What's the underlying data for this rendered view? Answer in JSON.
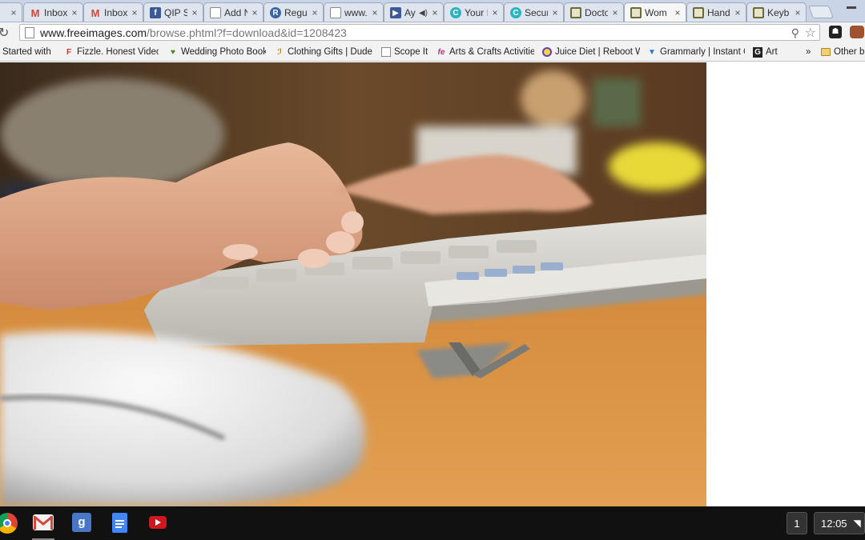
{
  "tabs": [
    {
      "title": "",
      "icon": "page-icon",
      "close": "×"
    },
    {
      "title": "Inbox",
      "icon": "gmail-icon",
      "close": "×"
    },
    {
      "title": "Inbox",
      "icon": "gmail-icon",
      "close": "×"
    },
    {
      "title": "QIP S",
      "icon": "facebook-icon",
      "close": "×"
    },
    {
      "title": "Add N",
      "icon": "page-icon",
      "close": "×"
    },
    {
      "title": "Regul",
      "icon": "regulator-icon",
      "close": "×"
    },
    {
      "title": "www.",
      "icon": "page-icon",
      "close": "×"
    },
    {
      "title": "Ay",
      "icon": "video-icon",
      "close": "×"
    },
    {
      "title": "Your I",
      "icon": "c-icon",
      "close": "×"
    },
    {
      "title": "Secur",
      "icon": "c-icon",
      "close": "×"
    },
    {
      "title": "Docto",
      "icon": "photo-icon",
      "close": "×"
    },
    {
      "title": "Wom",
      "icon": "photo-icon",
      "close": "×"
    },
    {
      "title": "Hand",
      "icon": "photo-icon",
      "close": "×"
    },
    {
      "title": "Keyb",
      "icon": "photo-icon",
      "close": "×"
    }
  ],
  "address_bar": {
    "host": "www.freeimages.com",
    "path": "/browse.phtml?f=download&id=1208423"
  },
  "bookmarks": [
    {
      "label": "Started with",
      "icon": "none"
    },
    {
      "label": "Fizzle. Honest Video",
      "icon": "fizzle-icon"
    },
    {
      "label": "Wedding Photo Book",
      "icon": "wedding-icon"
    },
    {
      "label": "Clothing Gifts | Dude",
      "icon": "clothing-icon"
    },
    {
      "label": "Scope It",
      "icon": "page-icon"
    },
    {
      "label": "Arts & Crafts Activitie",
      "icon": "fe-icon"
    },
    {
      "label": "Juice Diet | Reboot W",
      "icon": "juice-icon"
    },
    {
      "label": "Grammarly | Instant G",
      "icon": "grammarly-icon"
    },
    {
      "label": "Art",
      "icon": "g-icon"
    },
    {
      "label": "»",
      "icon": "none"
    },
    {
      "label": "Other b",
      "icon": "folder-icon"
    }
  ],
  "shelf": {
    "apps": [
      "chrome-icon",
      "gmail-icon",
      "google-plus-icon",
      "docs-icon",
      "youtube-icon"
    ],
    "notification_count": "1",
    "clock": "12:05"
  },
  "colors": {
    "tabstrip": "#c9d4e6",
    "shelf": "#111111",
    "gmail_red": "#d44638",
    "youtube_red": "#cc181e",
    "docs_blue": "#4285f4"
  }
}
